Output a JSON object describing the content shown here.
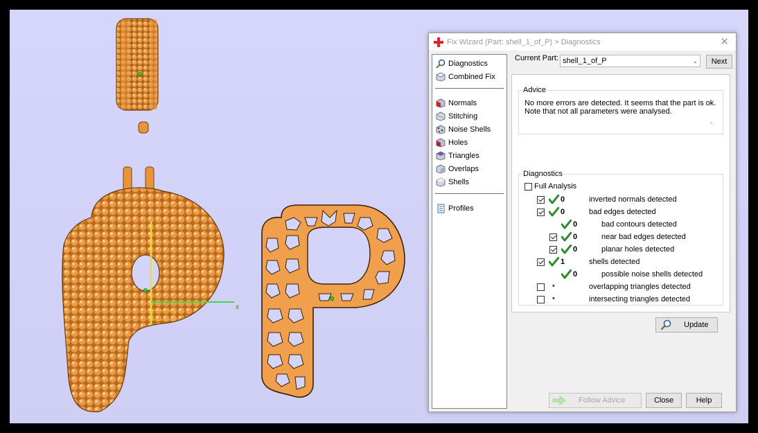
{
  "window": {
    "title": "Fix Wizard (Part: shell_1_of_P) > Diagnostics",
    "close_glyph": "✕"
  },
  "nav": {
    "top": [
      {
        "label": "Diagnostics",
        "icon": "magnifier-icon"
      },
      {
        "label": "Combined Fix",
        "icon": "cube-icon"
      }
    ],
    "tools": [
      {
        "label": "Normals",
        "icon": "normals-cube-icon"
      },
      {
        "label": "Stitching",
        "icon": "stitching-cube-icon"
      },
      {
        "label": "Noise Shells",
        "icon": "noise-shells-icon"
      },
      {
        "label": "Holes",
        "icon": "holes-cube-icon"
      },
      {
        "label": "Triangles",
        "icon": "triangles-cube-icon"
      },
      {
        "label": "Overlaps",
        "icon": "overlaps-cube-icon"
      },
      {
        "label": "Shells",
        "icon": "shells-cube-icon"
      }
    ],
    "bottom": [
      {
        "label": "Profiles",
        "icon": "document-icon"
      }
    ]
  },
  "part": {
    "label": "Current Part:",
    "value": "shell_1_of_P",
    "next_label": "Next"
  },
  "advice": {
    "group_label": "Advice",
    "text_line1": "No more errors are detected. It seems that the part is ok.",
    "text_line2": "Note that not all parameters were analysed."
  },
  "diagnostics": {
    "group_label": "Diagnostics",
    "full_analysis_label": "Full Analysis",
    "full_analysis_checked": false,
    "rows": [
      {
        "checked": true,
        "status": "ok",
        "count": "0",
        "label": "inverted normals detected",
        "indent": 0
      },
      {
        "checked": true,
        "status": "ok",
        "count": "0",
        "label": "bad edges detected",
        "indent": 0
      },
      {
        "checked": null,
        "status": "ok",
        "count": "0",
        "label": "bad contours detected",
        "indent": 2
      },
      {
        "checked": true,
        "status": "ok",
        "count": "0",
        "label": "near bad edges detected",
        "indent": 1
      },
      {
        "checked": true,
        "status": "ok",
        "count": "0",
        "label": "planar holes detected",
        "indent": 1
      },
      {
        "checked": true,
        "status": "ok",
        "count": "1",
        "label": "shells detected",
        "indent": 0
      },
      {
        "checked": null,
        "status": "ok",
        "count": "0",
        "label": "possible noise shells detected",
        "indent": 2
      },
      {
        "checked": false,
        "status": "pending",
        "count": "•",
        "label": "overlapping triangles detected",
        "indent": 0
      },
      {
        "checked": false,
        "status": "pending",
        "count": "•",
        "label": "intersecting triangles detected",
        "indent": 0
      }
    ],
    "update_label": "Update"
  },
  "buttons": {
    "follow_advice": "Follow Advice",
    "close": "Close",
    "help": "Help"
  },
  "viewport_overlay": {
    "axis_label": "x"
  },
  "colors": {
    "model": "#e8943a",
    "model_dark": "#a95a12",
    "background": "#d4d4f8",
    "check_green": "#2e8b2e",
    "accent_red": "#d8262a"
  }
}
